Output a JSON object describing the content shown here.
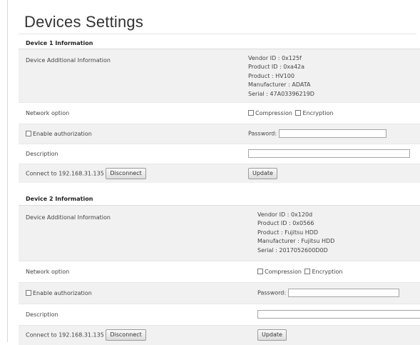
{
  "page": {
    "title": "Devices Settings"
  },
  "devices": [
    {
      "header": "Device 1 Information",
      "additional_label": "Device Additional Information",
      "info": {
        "vendor": "Vendor ID : 0x125f",
        "product_id": "Product ID : 0xa42a",
        "product": "Product : HV100",
        "manufacturer": "Manufacturer : ADATA",
        "serial": "Serial : 47A03396219D"
      },
      "network_label": "Network option",
      "compression_label": "Compression",
      "encryption_label": "Encryption",
      "enable_auth_label": "Enable authorization",
      "password_label": "Password:",
      "password_value": "",
      "description_label": "Description",
      "description_value": "",
      "connect_text": "Connect to 192.168.31.135",
      "disconnect_label": "Disconnect",
      "update_label": "Update"
    },
    {
      "header": "Device 2 Information",
      "additional_label": "Device Additional Information",
      "info": {
        "vendor": "Vendor ID : 0x120d",
        "product_id": "Product ID : 0x0566",
        "product": "Product : Fujitsu HDD",
        "manufacturer": "Manufacturer : Fujitsu HDD",
        "serial": "Serial : 2017052600D0D"
      },
      "network_label": "Network option",
      "compression_label": "Compression",
      "encryption_label": "Encryption",
      "enable_auth_label": "Enable authorization",
      "password_label": "Password:",
      "password_value": "",
      "description_label": "Description",
      "description_value": "",
      "connect_text": "Connect to 192.168.31.135",
      "disconnect_label": "Disconnect",
      "update_label": "Update"
    }
  ]
}
